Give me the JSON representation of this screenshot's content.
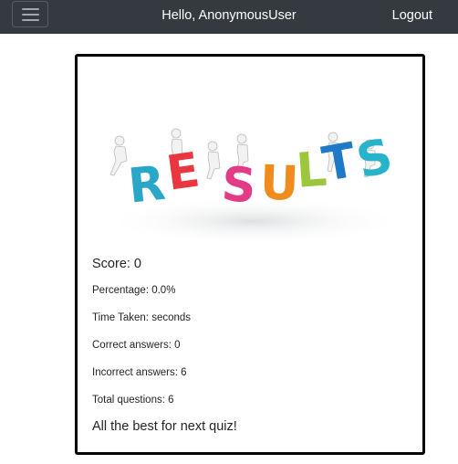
{
  "navbar": {
    "menu_icon": "hamburger-menu-icon",
    "greeting": "Hello, AnonymousUser",
    "logout_label": "Logout",
    "background_color": "#343a40"
  },
  "result_card": {
    "image_letters": [
      "R",
      "E",
      "S",
      "U",
      "L",
      "T",
      "S"
    ],
    "image_letter_colors": [
      "#2aa6c9",
      "#e8373e",
      "#e33b86",
      "#f08c1e",
      "#9cc63b",
      "#1e79c6",
      "#27b3c9"
    ],
    "score": "Score: 0",
    "percentage": "Percentage: 0.0%",
    "time_taken": "Time Taken: seconds",
    "correct_answers": "Correct answers: 0",
    "incorrect_answers": "Incorrect answers: 6",
    "total_questions": "Total questions: 6",
    "closing_message": "All the best for next quiz!"
  }
}
